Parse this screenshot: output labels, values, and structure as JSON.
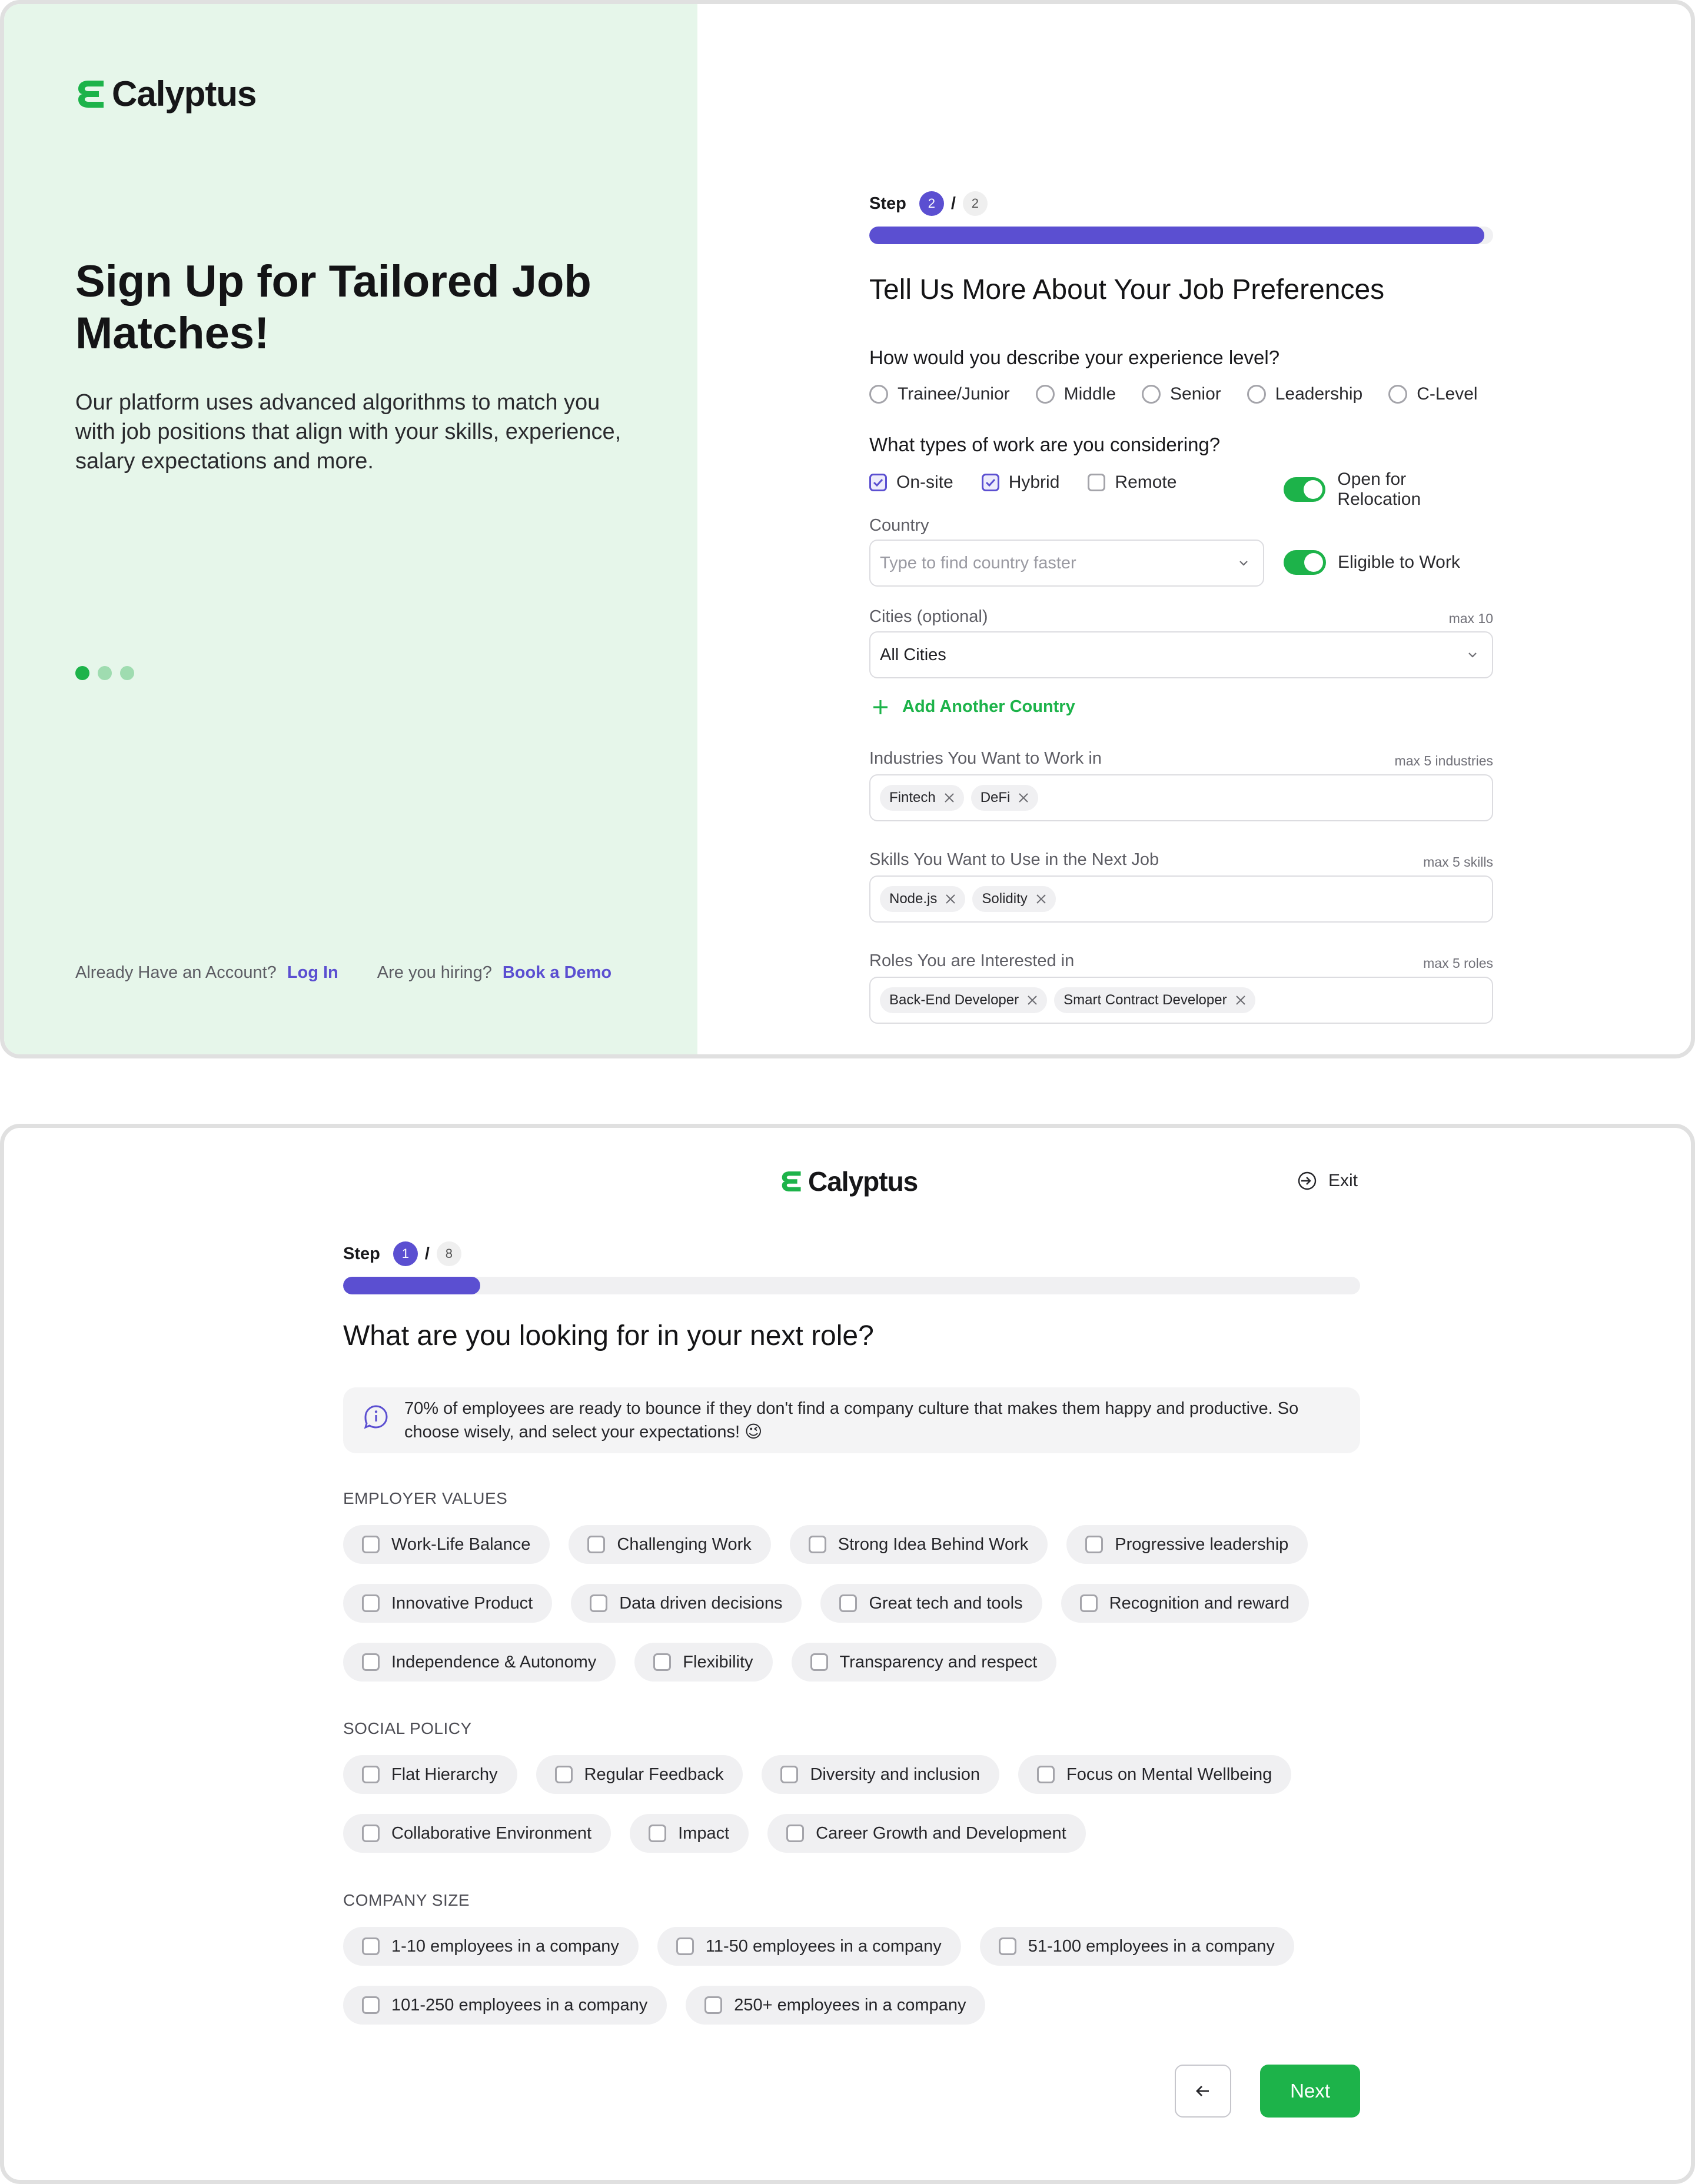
{
  "screen1": {
    "brand": "Calyptus",
    "hero_title": "Sign Up for Tailored Job Matches!",
    "hero_desc": "Our platform uses advanced algorithms to match you with job positions that align with your skills, experience, salary expectations and more.",
    "carousel_dots": 3,
    "footer": {
      "account_text": "Already Have an Account?",
      "login_label": "Log In",
      "hiring_text": "Are you hiring?",
      "demo_label": "Book a Demo"
    },
    "step": {
      "label": "Step",
      "current": "2",
      "separator": "/",
      "total": "2",
      "progress": 1.0
    },
    "title": "Tell Us More About Your Job Preferences",
    "experience": {
      "question": "How would you describe your experience level?",
      "options": [
        "Trainee/Junior",
        "Middle",
        "Senior",
        "Leadership",
        "C-Level"
      ]
    },
    "work_types": {
      "question": "What types of work are you considering?",
      "options": [
        {
          "label": "On-site",
          "checked": true
        },
        {
          "label": "Hybrid",
          "checked": true
        },
        {
          "label": "Remote",
          "checked": false
        }
      ],
      "relocation_label": "Open for Relocation",
      "relocation_on": true
    },
    "country": {
      "label": "Country",
      "placeholder": "Type to find country faster",
      "eligible_label": "Eligible to Work",
      "eligible_on": true
    },
    "cities": {
      "label": "Cities (optional)",
      "max": "max 10",
      "value": "All Cities"
    },
    "add_country_label": "Add Another Country",
    "industries": {
      "label": "Industries You Want to Work in",
      "max": "max 5 industries",
      "tags": [
        "Fintech",
        "DeFi"
      ]
    },
    "skills": {
      "label": "Skills You Want to Use in the Next Job",
      "max": "max 5 skills",
      "tags": [
        "Node.js",
        "Solidity"
      ]
    },
    "roles": {
      "label": "Roles You are Interested in",
      "max": "max 5 roles",
      "tags": [
        "Back-End Developer",
        "Smart Contract Developer"
      ]
    }
  },
  "screen2": {
    "brand": "Calyptus",
    "exit_label": "Exit",
    "step": {
      "label": "Step",
      "current": "1",
      "separator": "/",
      "total": "8",
      "progress": 0.135
    },
    "title": "What are you looking for in your next role?",
    "info": "70% of employees are ready to bounce if they don't find a company culture that makes them happy and productive. So choose wisely, and select your expectations! 😉",
    "employer_values": {
      "heading": "EMPLOYER VALUES",
      "rows": [
        [
          "Work-Life Balance",
          "Challenging Work",
          "Strong Idea Behind Work",
          "Progressive leadership"
        ],
        [
          "Innovative Product",
          "Data driven decisions",
          "Great tech and tools",
          "Recognition and reward"
        ],
        [
          "Independence & Autonomy",
          "Flexibility",
          "Transparency and respect"
        ]
      ]
    },
    "social_policy": {
      "heading": "SOCIAL POLICY",
      "rows": [
        [
          "Flat Hierarchy",
          "Regular Feedback",
          "Diversity and inclusion",
          "Focus on Mental Wellbeing"
        ],
        [
          "Collaborative Environment",
          "Impact",
          "Career Growth and Development"
        ]
      ]
    },
    "company_size": {
      "heading": "COMPANY SIZE",
      "rows": [
        [
          "1-10 employees in a company",
          "11-50 employees in a company",
          "51-100 employees in a company"
        ],
        [
          "101-250 employees in a company",
          "250+ employees in a company"
        ]
      ]
    },
    "next_label": "Next",
    "colors": {
      "accent": "#5b4fd1",
      "brand_green": "#1db34a",
      "panel_bg": "#e6f6ea"
    }
  }
}
